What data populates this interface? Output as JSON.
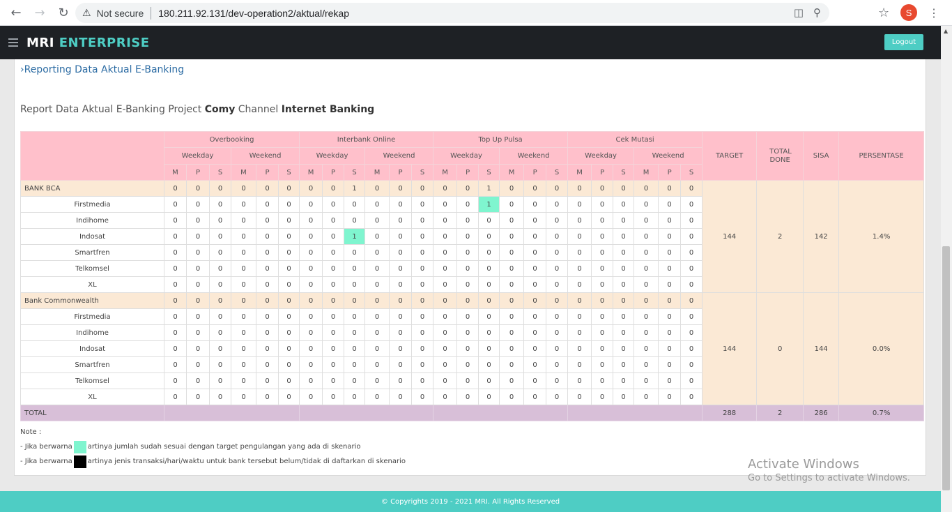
{
  "browser": {
    "security_label": "Not secure",
    "url": "180.211.92.131/dev-operation2/aktual/rekap",
    "avatar_letter": "S"
  },
  "header": {
    "brand_part1": "MRI",
    "brand_part2": "ENTERPRISE",
    "logout_label": "Logout"
  },
  "breadcrumb": "›Reporting Data Aktual E-Banking",
  "report_title": {
    "prefix": "Report Data Aktual E-Banking Project ",
    "project": "Comy",
    "middle": " Channel ",
    "channel": "Internet Banking"
  },
  "table": {
    "groups": [
      "Overbooking",
      "Interbank Online",
      "Top Up Pulsa",
      "Cek Mutasi"
    ],
    "subgroups": [
      "Weekday",
      "Weekend"
    ],
    "cols": [
      "M",
      "P",
      "S"
    ],
    "summary_headers": [
      "TARGET",
      "TOTAL DONE",
      "SISA",
      "PERSENTASE"
    ],
    "banks": [
      {
        "name": "BANK BCA",
        "totals": [
          0,
          0,
          0,
          0,
          0,
          0,
          0,
          0,
          1,
          0,
          0,
          0,
          0,
          0,
          1,
          0,
          0,
          0,
          0,
          0,
          0,
          0,
          0,
          0
        ],
        "target": "144",
        "done": "2",
        "sisa": "142",
        "persen": "1.4%",
        "rows": [
          {
            "name": "Firstmedia",
            "values": [
              0,
              0,
              0,
              0,
              0,
              0,
              0,
              0,
              0,
              0,
              0,
              0,
              0,
              0,
              1,
              0,
              0,
              0,
              0,
              0,
              0,
              0,
              0,
              0
            ],
            "hl": [
              14
            ]
          },
          {
            "name": "Indihome",
            "values": [
              0,
              0,
              0,
              0,
              0,
              0,
              0,
              0,
              0,
              0,
              0,
              0,
              0,
              0,
              0,
              0,
              0,
              0,
              0,
              0,
              0,
              0,
              0,
              0
            ],
            "hl": []
          },
          {
            "name": "Indosat",
            "values": [
              0,
              0,
              0,
              0,
              0,
              0,
              0,
              0,
              1,
              0,
              0,
              0,
              0,
              0,
              0,
              0,
              0,
              0,
              0,
              0,
              0,
              0,
              0,
              0
            ],
            "hl": [
              8
            ]
          },
          {
            "name": "Smartfren",
            "values": [
              0,
              0,
              0,
              0,
              0,
              0,
              0,
              0,
              0,
              0,
              0,
              0,
              0,
              0,
              0,
              0,
              0,
              0,
              0,
              0,
              0,
              0,
              0,
              0
            ],
            "hl": []
          },
          {
            "name": "Telkomsel",
            "values": [
              0,
              0,
              0,
              0,
              0,
              0,
              0,
              0,
              0,
              0,
              0,
              0,
              0,
              0,
              0,
              0,
              0,
              0,
              0,
              0,
              0,
              0,
              0,
              0
            ],
            "hl": []
          },
          {
            "name": "XL",
            "values": [
              0,
              0,
              0,
              0,
              0,
              0,
              0,
              0,
              0,
              0,
              0,
              0,
              0,
              0,
              0,
              0,
              0,
              0,
              0,
              0,
              0,
              0,
              0,
              0
            ],
            "hl": []
          }
        ]
      },
      {
        "name": "Bank Commonwealth",
        "totals": [
          0,
          0,
          0,
          0,
          0,
          0,
          0,
          0,
          0,
          0,
          0,
          0,
          0,
          0,
          0,
          0,
          0,
          0,
          0,
          0,
          0,
          0,
          0,
          0
        ],
        "target": "144",
        "done": "0",
        "sisa": "144",
        "persen": "0.0%",
        "rows": [
          {
            "name": "Firstmedia",
            "values": [
              0,
              0,
              0,
              0,
              0,
              0,
              0,
              0,
              0,
              0,
              0,
              0,
              0,
              0,
              0,
              0,
              0,
              0,
              0,
              0,
              0,
              0,
              0,
              0
            ],
            "hl": []
          },
          {
            "name": "Indihome",
            "values": [
              0,
              0,
              0,
              0,
              0,
              0,
              0,
              0,
              0,
              0,
              0,
              0,
              0,
              0,
              0,
              0,
              0,
              0,
              0,
              0,
              0,
              0,
              0,
              0
            ],
            "hl": []
          },
          {
            "name": "Indosat",
            "values": [
              0,
              0,
              0,
              0,
              0,
              0,
              0,
              0,
              0,
              0,
              0,
              0,
              0,
              0,
              0,
              0,
              0,
              0,
              0,
              0,
              0,
              0,
              0,
              0
            ],
            "hl": []
          },
          {
            "name": "Smartfren",
            "values": [
              0,
              0,
              0,
              0,
              0,
              0,
              0,
              0,
              0,
              0,
              0,
              0,
              0,
              0,
              0,
              0,
              0,
              0,
              0,
              0,
              0,
              0,
              0,
              0
            ],
            "hl": []
          },
          {
            "name": "Telkomsel",
            "values": [
              0,
              0,
              0,
              0,
              0,
              0,
              0,
              0,
              0,
              0,
              0,
              0,
              0,
              0,
              0,
              0,
              0,
              0,
              0,
              0,
              0,
              0,
              0,
              0
            ],
            "hl": []
          },
          {
            "name": "XL",
            "values": [
              0,
              0,
              0,
              0,
              0,
              0,
              0,
              0,
              0,
              0,
              0,
              0,
              0,
              0,
              0,
              0,
              0,
              0,
              0,
              0,
              0,
              0,
              0,
              0
            ],
            "hl": []
          }
        ]
      }
    ],
    "total": {
      "label": "TOTAL",
      "target": "288",
      "done": "2",
      "sisa": "286",
      "persen": "0.7%"
    }
  },
  "notes": {
    "title": "Note :",
    "line1_prefix": "- Jika berwarna",
    "line1_text": "artinya jumlah sudah sesuai dengan target pengulangan yang ada di skenario",
    "line2_prefix": "- Jika berwarna",
    "line2_text": "artinya jenis transaksi/hari/waktu untuk bank tersebut belum/tidak di daftarkan di skenario"
  },
  "colors": {
    "accent": "#4ecdc4",
    "header_pink": "#ffc0cb",
    "bank_row": "#fbe9d5",
    "highlight": "#7ff5cf",
    "total_row": "#d8bfd8",
    "unregistered": "#000000"
  },
  "watermark": {
    "line1": "Activate Windows",
    "line2": "Go to Settings to activate Windows."
  },
  "footer": "© Copyrights 2019 - 2021 MRI. All Rights Reserved"
}
